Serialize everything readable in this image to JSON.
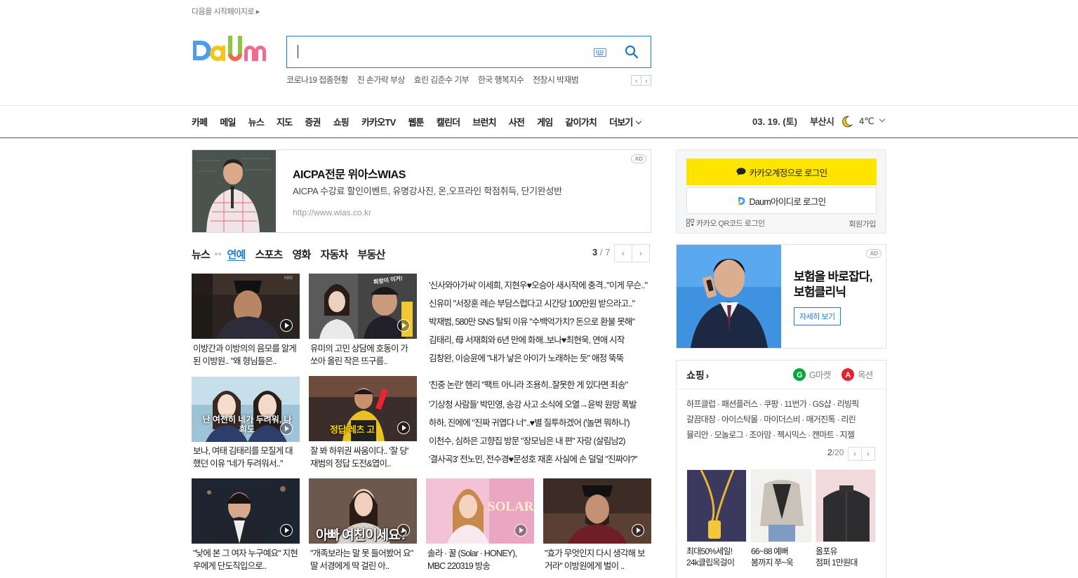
{
  "top": {
    "start_page": "다음을 시작페이지로 ▸",
    "search_value": "",
    "trends": [
      "코로나19 접종현황",
      "진 손가락 부상",
      "효린 김준수 기부",
      "한국 행복지수",
      "전창시 박재범"
    ]
  },
  "nav": {
    "items": [
      "카페",
      "메일",
      "뉴스",
      "지도",
      "증권",
      "쇼핑",
      "카카오TV",
      "웹툰",
      "캘린더",
      "브런치",
      "사전",
      "게임",
      "같이가치"
    ],
    "more": "더보기",
    "date": "03. 19. (토)",
    "city": "부산시",
    "temp": "4℃"
  },
  "ad1": {
    "badge": "AD",
    "title": "AICPA전문 위아스WIAS",
    "desc": "AICPA 수강료 할인이벤트, 유명강사진, 온,오프라인 학점취득, 단기완성반",
    "url": "http://www.wias.co.kr"
  },
  "news": {
    "tabs": [
      "뉴스",
      "연예",
      "스포츠",
      "영화",
      "자동차",
      "부동산"
    ],
    "page_current": "3",
    "page_total": " / 7",
    "row1_caps": [
      "이방간과 이방의의 음모를 알게 된 이방원.. \"왜 형님들은..",
      "유미의 고민 상담에 호동이 가 쏘아 올린 작은 뜨구름.."
    ],
    "row1_headlines": [
      "'신사와아가씨' 이세희, 지현우♥오승아 새시작에 충격..\"이게 무슨..\"",
      "신유미 \"서장훈 레슨 부담스럽다고 시간당 100만원 받으라고..\"",
      "박재범, 580만 SNS 탈퇴 이유 \"수백억가치? 돈으로 환불 못해\"",
      "김태리, 母 서재희와 6년 만에 화해..보나♥최현욱, 연애 시작",
      "김창완, 이승윤에 \"내가 낳은 아이가 노래하는 듯\" 애정 뚝뚝"
    ],
    "row2_caps": [
      "보나, 여태 김태리를 모질게 대했던 이유 \"네가 두려워서..\"",
      "잘 봐 하위권 싸움이다.. '잘 당' 재범의 정답 도전&엽이.."
    ],
    "row2_headlines": [
      "'친중 논란' 헨리 \"팩트 아니라 조용히..잘못한 게 있다면 죄송\"",
      "'기상청 사람들' 박민영, 송강 사고 소식에 오열→윤박 원망 폭발",
      "하하, 진에에 \"진짜 귀엽다 너\"..♥별 질투하겠어 ('놀면 뭐하니')",
      "이천수, 심하은 고향집 방문 \"장모님은 내 편\" 자랑 (살림남2)",
      "'결사곡3' 전노민, 전수경♥문성호 재혼 사실에 손 덜덜 \"진짜야?\""
    ],
    "row3_caps": [
      "\"낮에 본 그 여자 누구예요\" 지현우에게 단도직입으로..",
      "\"개족보라는 말 못 들어봤어 요\" 딸 서경에게 딱 걸린 아..",
      "솔라 · 꿀 (Solar · HONEY), MBC 220319 방송",
      "\"효가 무엇인지 다시 생각해 보거라\" 이방원에게 벌이 .."
    ],
    "thumb_texts": {
      "t1": "KBS",
      "t2": "희망이 이거!",
      "t3": "난 여전히 네가 두려워, 나희도",
      "t4": "정답 레츠 고",
      "t5": "아빠 여친이세요?",
      "t6": "SOLAR"
    }
  },
  "login": {
    "kakao": "카카오계정으로 로그인",
    "daum": "Daum아이디로 로그인",
    "qr": "카카오 QR코드 로그인",
    "signup": "회원가입"
  },
  "ad2": {
    "badge": "AD",
    "title": "보험을 바로잡다, 보험클리닉",
    "button": "자세히 보기"
  },
  "shop": {
    "title": "쇼핑",
    "gmarket": "G마켓",
    "auction": "옥션",
    "links": [
      "하프클럽 · 패션플러스 · 쿠팡 · 11번가 · GS샵 · 리빙픽",
      "갈끔대장 · 아이스탁몰 · 마이더스비 · 매거진톡 · 리린",
      "뮬리안 · 모놀로그 · 조아맘 · 젝시믹스 · 캔마트 · 지젤"
    ],
    "page_current": "2",
    "page_total": "/20",
    "products": [
      {
        "line1": "최대50%세일!",
        "line2": "24k클립목걸이"
      },
      {
        "line1": "66~88 예뻐",
        "line2": "봄까지 쭈~욱"
      },
      {
        "line1": "올포유",
        "line2": "점퍼 1만원대"
      }
    ]
  }
}
